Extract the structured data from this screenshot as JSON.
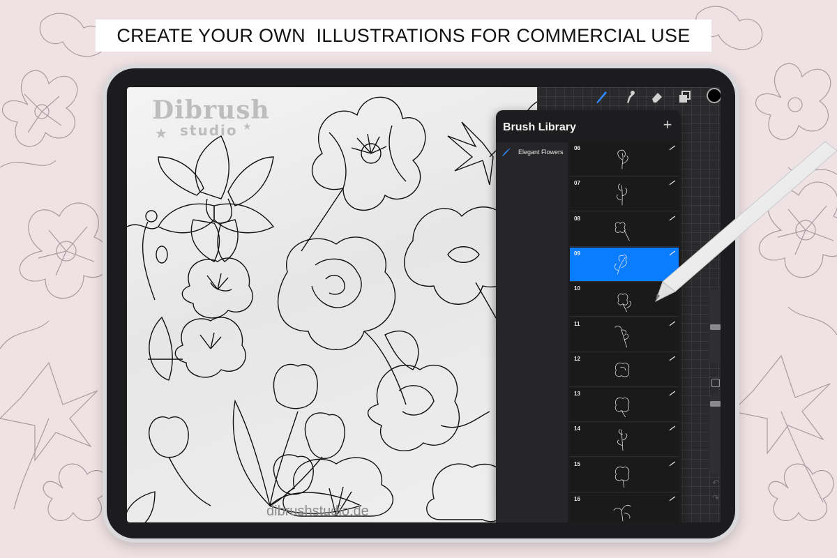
{
  "banner": {
    "text": "CREATE YOUR OWN  ILLUSTRATIONS FOR COMMERCIAL USE"
  },
  "canvas": {
    "brand_name": "Dibrush",
    "brand_sub": "studio",
    "site_url": "dibrushstudio.de"
  },
  "toolbar": {
    "tools": [
      {
        "name": "brush-icon",
        "active": true
      },
      {
        "name": "smudge-icon",
        "active": false
      },
      {
        "name": "eraser-icon",
        "active": false
      },
      {
        "name": "layers-icon",
        "active": false
      }
    ],
    "color": "#000000"
  },
  "brush_library": {
    "title": "Brush Library",
    "add_label": "+",
    "sets": [
      {
        "label": "Elegant Flowers"
      }
    ],
    "brushes": [
      {
        "number": "06",
        "selected": false
      },
      {
        "number": "07",
        "selected": false
      },
      {
        "number": "08",
        "selected": false
      },
      {
        "number": "09",
        "selected": true
      },
      {
        "number": "10",
        "selected": false
      },
      {
        "number": "11",
        "selected": false
      },
      {
        "number": "12",
        "selected": false
      },
      {
        "number": "13",
        "selected": false
      },
      {
        "number": "14",
        "selected": false
      },
      {
        "number": "15",
        "selected": false
      },
      {
        "number": "16",
        "selected": false
      }
    ]
  },
  "colors": {
    "accent": "#0a7cff",
    "panel": "#1d1d1f",
    "background": "#efe2e4"
  }
}
